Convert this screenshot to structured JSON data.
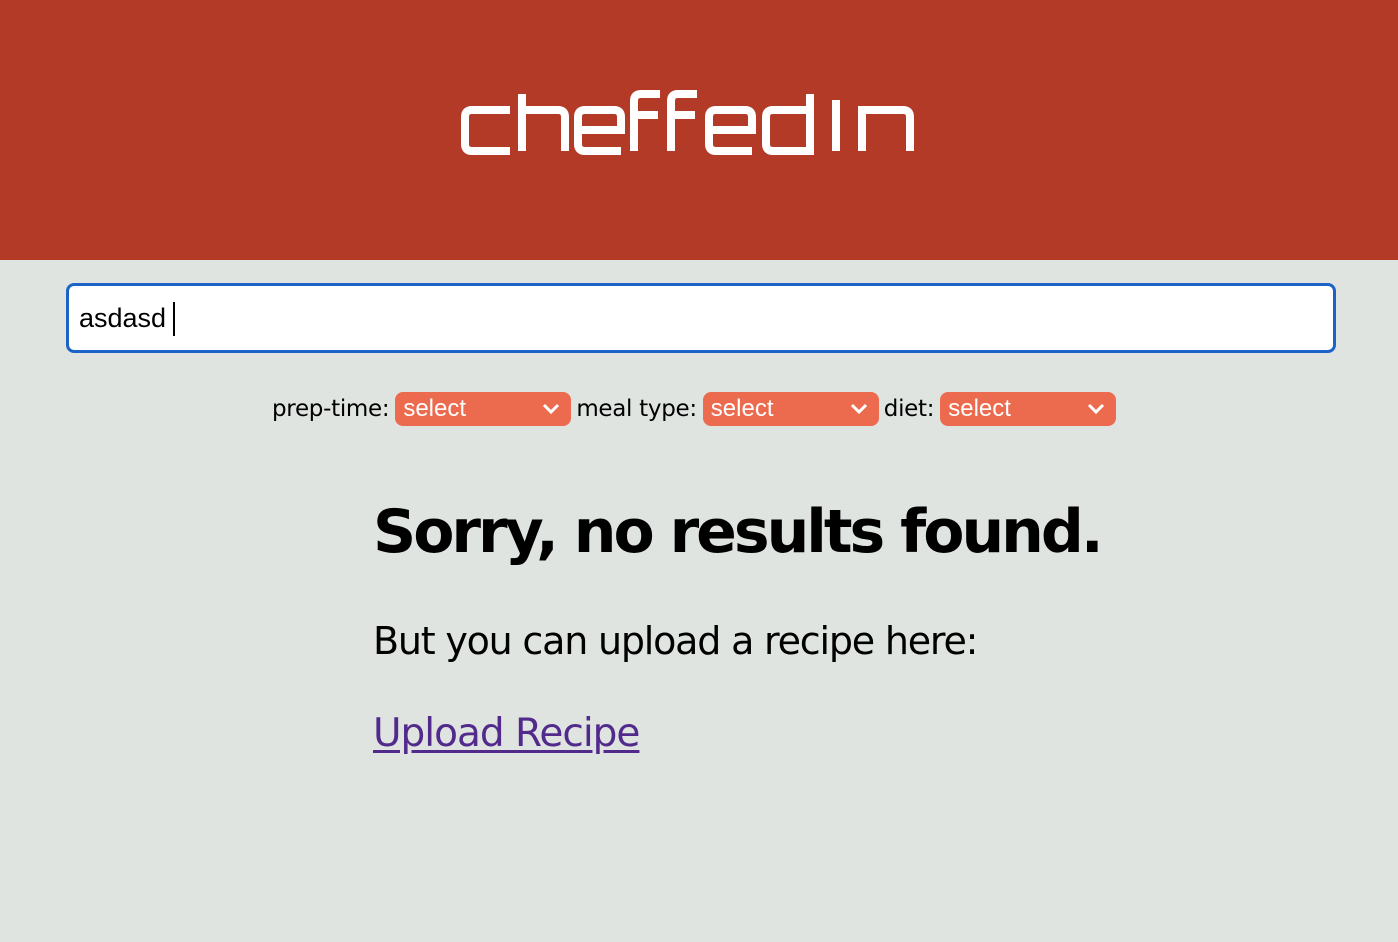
{
  "brand": {
    "name": "cheffedin",
    "header_color": "#b33a26",
    "accent_color": "#ec6a4e",
    "link_color": "#512a8c"
  },
  "search": {
    "value": "asdasd",
    "placeholder": ""
  },
  "filters": {
    "prep_time": {
      "label": "prep-time:",
      "selected": "select"
    },
    "meal_type": {
      "label": "meal type:",
      "selected": "select"
    },
    "diet": {
      "label": "diet:",
      "selected": "select"
    }
  },
  "results": {
    "empty_title": "Sorry, no results found.",
    "upload_prompt": "But you can upload a recipe here:",
    "upload_link": "Upload Recipe"
  },
  "icons": {
    "select_chevron": "chevron-down-icon"
  }
}
